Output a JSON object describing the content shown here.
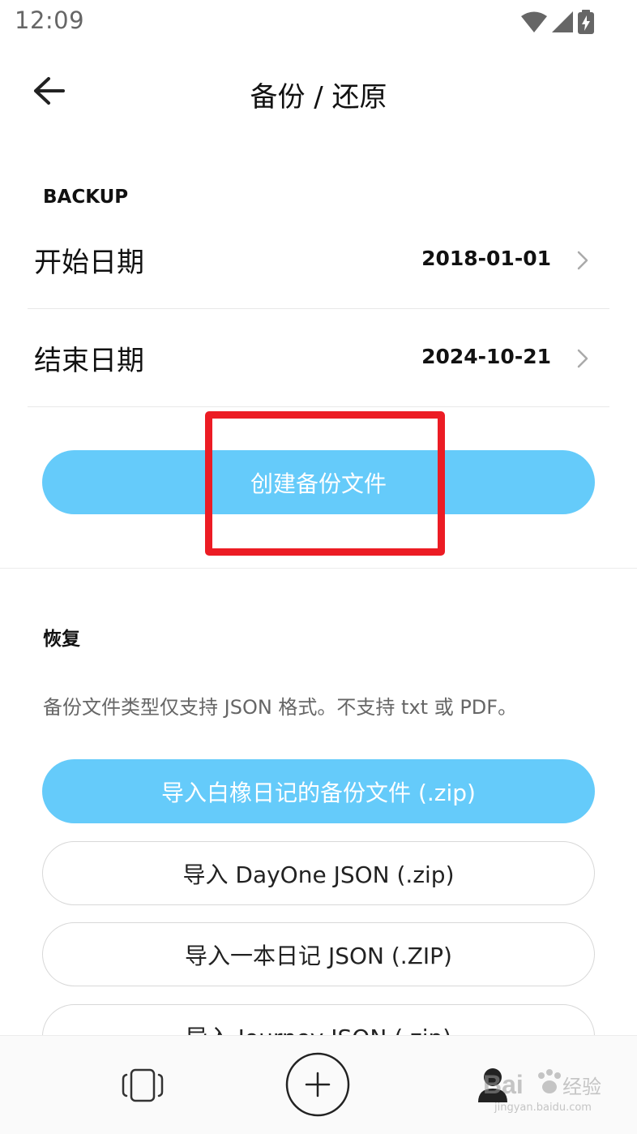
{
  "status_bar": {
    "time": "12:09",
    "icons": [
      "wifi-icon",
      "cellular-signal-icon",
      "battery-charging-icon"
    ]
  },
  "app_bar": {
    "title": "备份 / 还原",
    "back_icon": "arrow-left-icon"
  },
  "backup_section": {
    "label": "BACKUP",
    "rows": [
      {
        "label": "开始日期",
        "value": "2018-01-01"
      },
      {
        "label": "结束日期",
        "value": "2024-10-21"
      }
    ],
    "create_button": "创建备份文件"
  },
  "restore_section": {
    "label": "恢复",
    "help_text": "备份文件类型仅支持 JSON 格式。不支持 txt 或 PDF。",
    "buttons": [
      "导入白橡日记的备份文件 (.zip)",
      "导入 DayOne JSON (.zip)",
      "导入一本日记 JSON (.ZIP)",
      "导入 Journey JSON (.zip)"
    ]
  },
  "bottom_nav": {
    "items": [
      "cards-icon",
      "add-icon",
      "profile-icon"
    ]
  },
  "watermark": {
    "brand": "Bai",
    "brand_cn": "经验",
    "url": "jingyan.baidu.com"
  },
  "colors": {
    "accent": "#65cbfa",
    "highlight": "#ec1c24",
    "text": "#111111",
    "muted": "#666666"
  }
}
